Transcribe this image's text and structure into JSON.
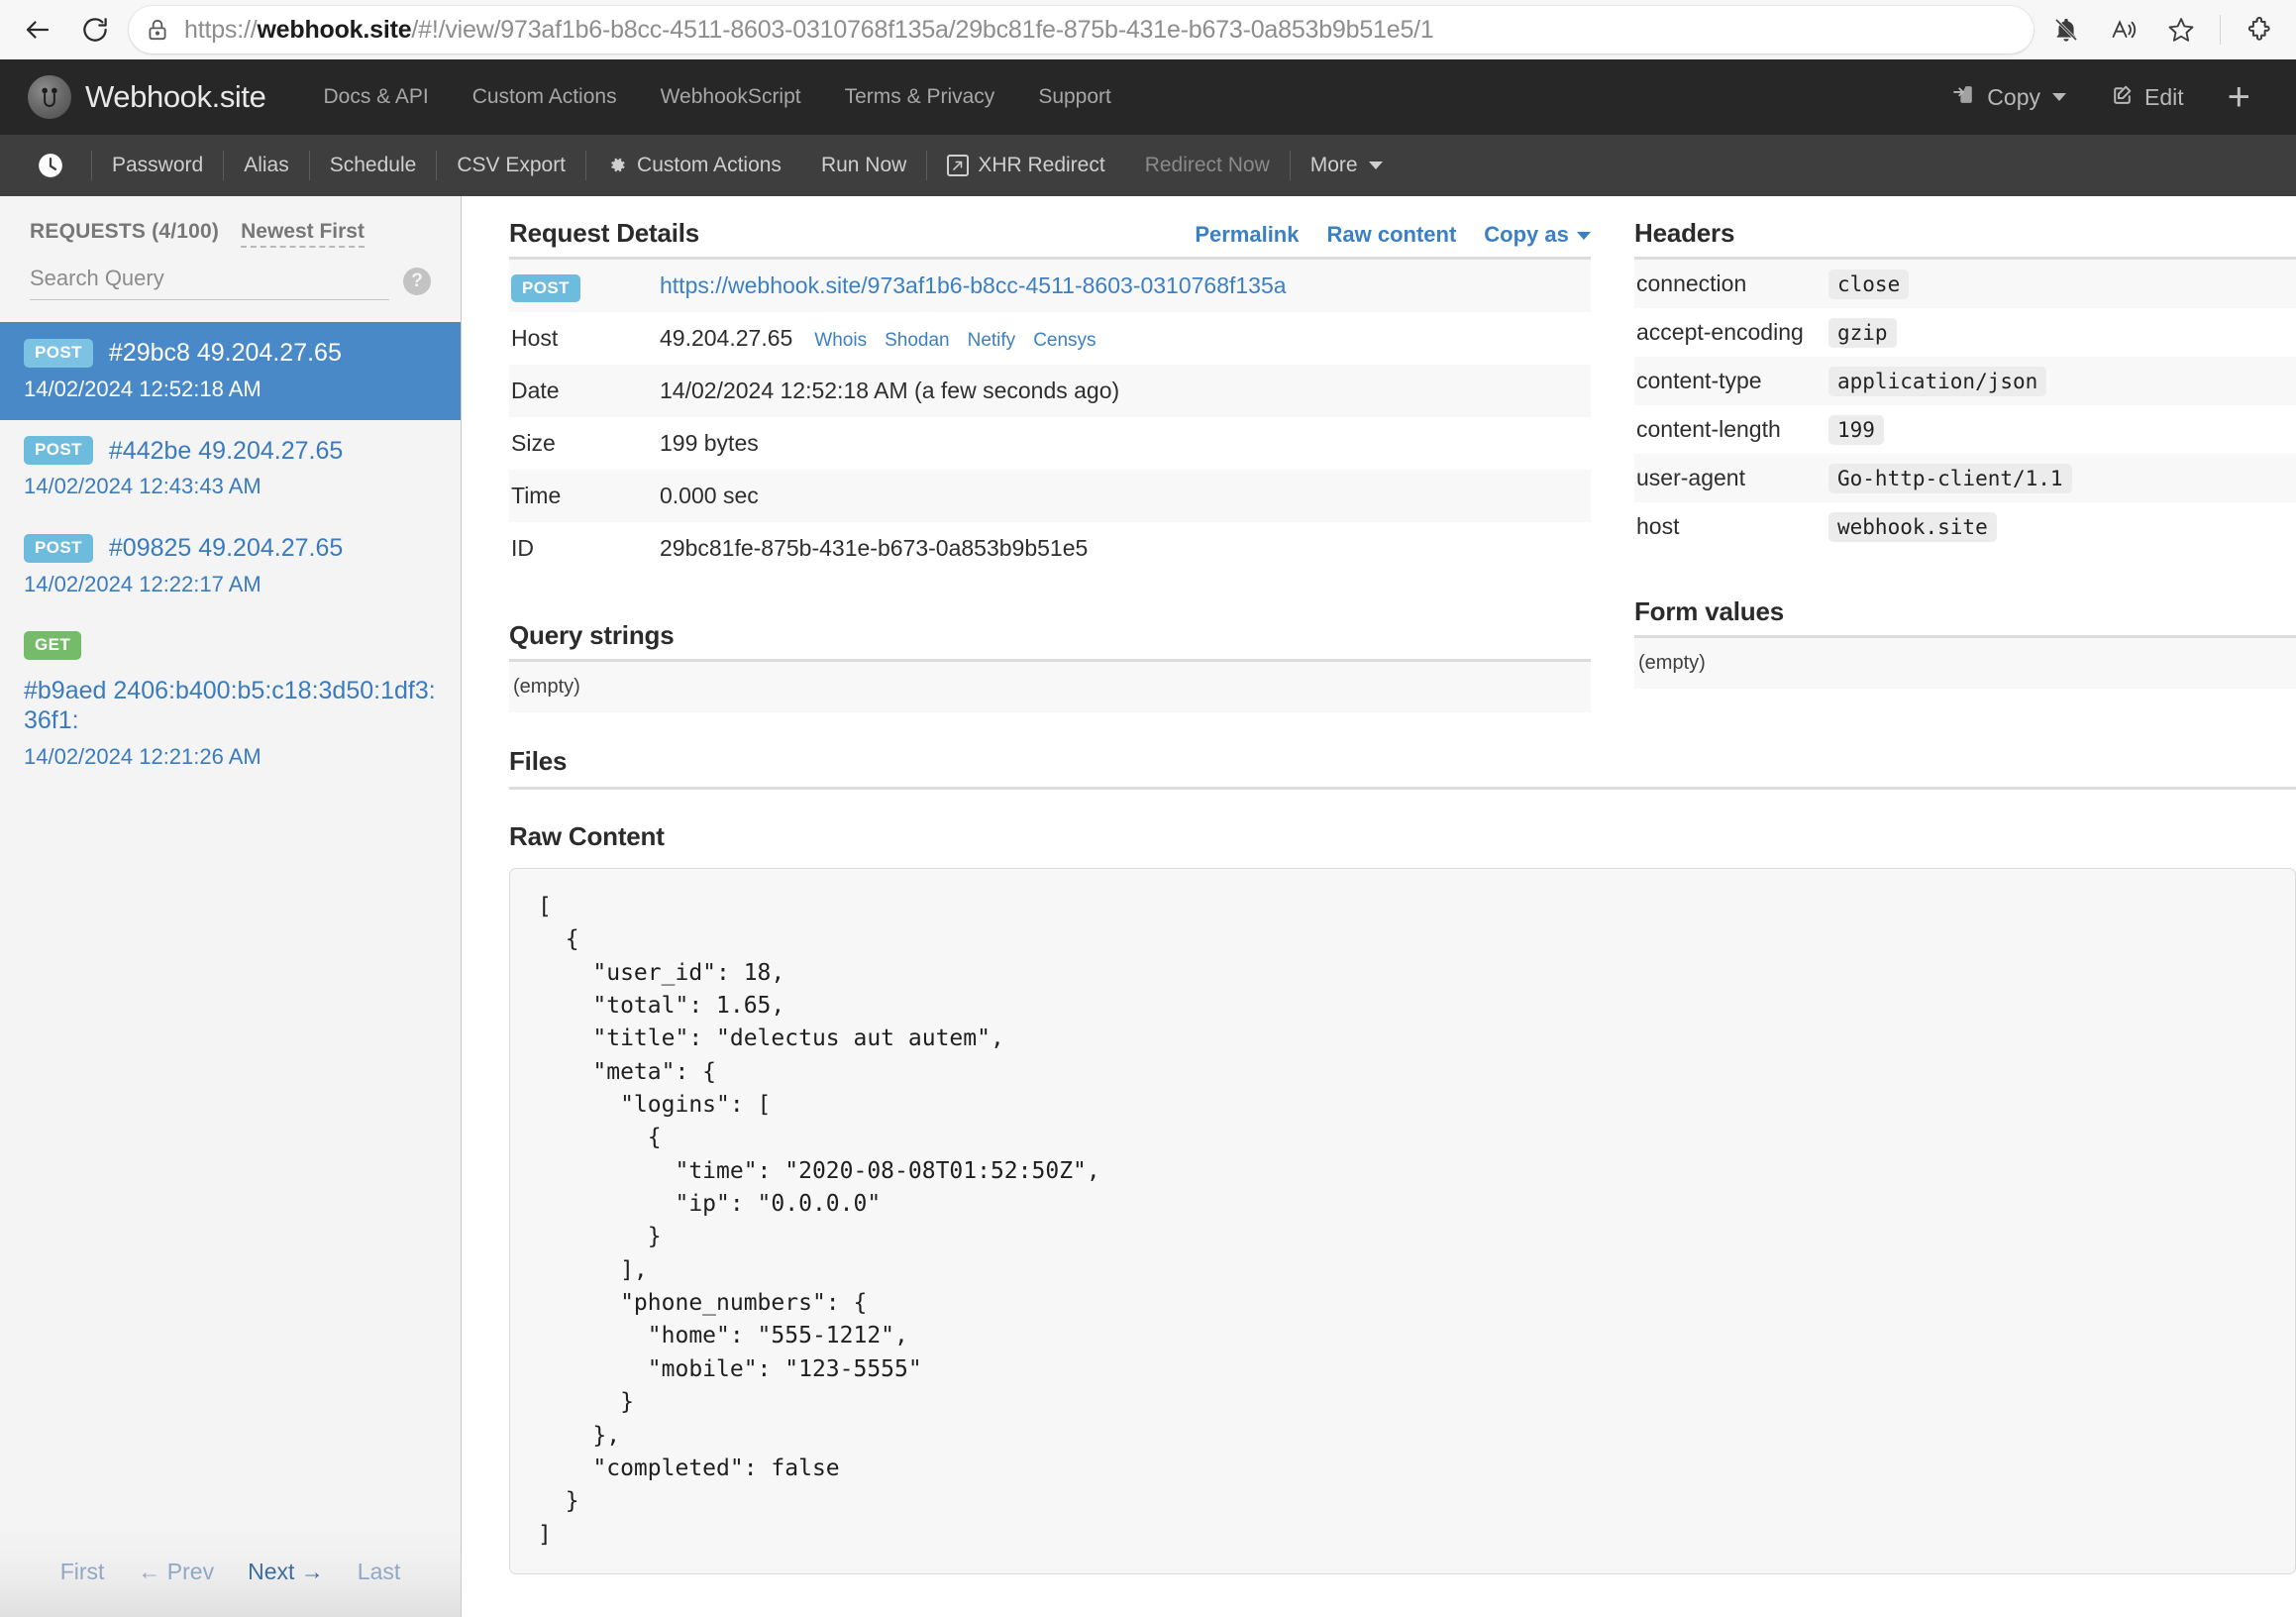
{
  "browser": {
    "back_icon": "back-arrow-icon",
    "reload_icon": "reload-icon",
    "lock_icon": "lock-icon",
    "url_prefix": "https://",
    "url_host": "webhook.site",
    "url_path": "/#!/view/973af1b6-b8cc-4511-8603-0310768f135a/29bc81fe-875b-431e-b673-0a853b9b51e5/1",
    "icons": [
      "bell-muted-icon",
      "read-aloud-icon",
      "favorite-star-icon",
      "extensions-puzzle-icon"
    ]
  },
  "topnav": {
    "brand": "Webhook.site",
    "links": [
      "Docs & API",
      "Custom Actions",
      "WebhookScript",
      "Terms & Privacy",
      "Support"
    ],
    "copy_label": "Copy",
    "edit_label": "Edit",
    "new_label": "+"
  },
  "subnav": {
    "items": [
      {
        "label": "Password",
        "muted": false,
        "icon": null
      },
      {
        "label": "Alias",
        "muted": false,
        "icon": null
      },
      {
        "label": "Schedule",
        "muted": false,
        "icon": null
      },
      {
        "label": "CSV Export",
        "muted": false,
        "icon": null
      },
      {
        "label": "Custom Actions",
        "muted": false,
        "icon": "gear-icon"
      },
      {
        "label": "Run Now",
        "muted": false,
        "icon": null
      },
      {
        "label": "XHR Redirect",
        "muted": false,
        "icon": "external-link-icon"
      },
      {
        "label": "Redirect Now",
        "muted": true,
        "icon": null
      },
      {
        "label": "More",
        "muted": false,
        "icon": "caret-down-icon"
      }
    ]
  },
  "sidebar": {
    "title": "REQUESTS (4/100)",
    "sort_label": "Newest First",
    "search_placeholder": "Search Query",
    "help_icon": "help-circle-icon",
    "requests": [
      {
        "method": "POST",
        "id": "#29bc8",
        "ip": "49.204.27.65",
        "time": "14/02/2024 12:52:18 AM",
        "selected": true
      },
      {
        "method": "POST",
        "id": "#442be",
        "ip": "49.204.27.65",
        "time": "14/02/2024 12:43:43 AM",
        "selected": false
      },
      {
        "method": "POST",
        "id": "#09825",
        "ip": "49.204.27.65",
        "time": "14/02/2024 12:22:17 AM",
        "selected": false
      },
      {
        "method": "GET",
        "id": "#b9aed",
        "ip": "2406:b400:b5:c18:3d50:1df3:36f1:",
        "time": "14/02/2024 12:21:26 AM",
        "selected": false
      }
    ],
    "pager": {
      "first": "First",
      "prev": "← Prev",
      "next": "Next →",
      "last": "Last"
    }
  },
  "request_details": {
    "title": "Request Details",
    "links": {
      "permalink": "Permalink",
      "raw_content": "Raw content",
      "copy_as": "Copy as"
    },
    "method": "POST",
    "url": "https://webhook.site/973af1b6-b8cc-4511-8603-0310768f135a",
    "rows": [
      {
        "key": "Host",
        "value": "49.204.27.65"
      },
      {
        "key": "Date",
        "value": "14/02/2024 12:52:18 AM (a few seconds ago)"
      },
      {
        "key": "Size",
        "value": "199 bytes"
      },
      {
        "key": "Time",
        "value": "0.000 sec"
      },
      {
        "key": "ID",
        "value": "29bc81fe-875b-431e-b673-0a853b9b51e5"
      }
    ],
    "host_links": [
      "Whois",
      "Shodan",
      "Netify",
      "Censys"
    ]
  },
  "headers": {
    "title": "Headers",
    "rows": [
      {
        "key": "connection",
        "value": "close"
      },
      {
        "key": "accept-encoding",
        "value": "gzip"
      },
      {
        "key": "content-type",
        "value": "application/json"
      },
      {
        "key": "content-length",
        "value": "199"
      },
      {
        "key": "user-agent",
        "value": "Go-http-client/1.1"
      },
      {
        "key": "host",
        "value": "webhook.site"
      }
    ]
  },
  "query_strings": {
    "title": "Query strings",
    "value": "(empty)"
  },
  "form_values": {
    "title": "Form values",
    "value": "(empty)"
  },
  "files": {
    "title": "Files"
  },
  "raw_content": {
    "title": "Raw Content",
    "body": "[\n  {\n    \"user_id\": 18,\n    \"total\": 1.65,\n    \"title\": \"delectus aut autem\",\n    \"meta\": {\n      \"logins\": [\n        {\n          \"time\": \"2020-08-08T01:52:50Z\",\n          \"ip\": \"0.0.0.0\"\n        }\n      ],\n      \"phone_numbers\": {\n        \"home\": \"555-1212\",\n        \"mobile\": \"123-5555\"\n      }\n    },\n    \"completed\": false\n  }\n]"
  },
  "colors": {
    "accent_blue": "#3b7fc4",
    "selected_row": "#4a89c8",
    "post_badge": "#6dbbdd",
    "get_badge": "#76bb6a",
    "topnav_bg": "#272727",
    "subnav_bg": "#3e3e3e"
  }
}
